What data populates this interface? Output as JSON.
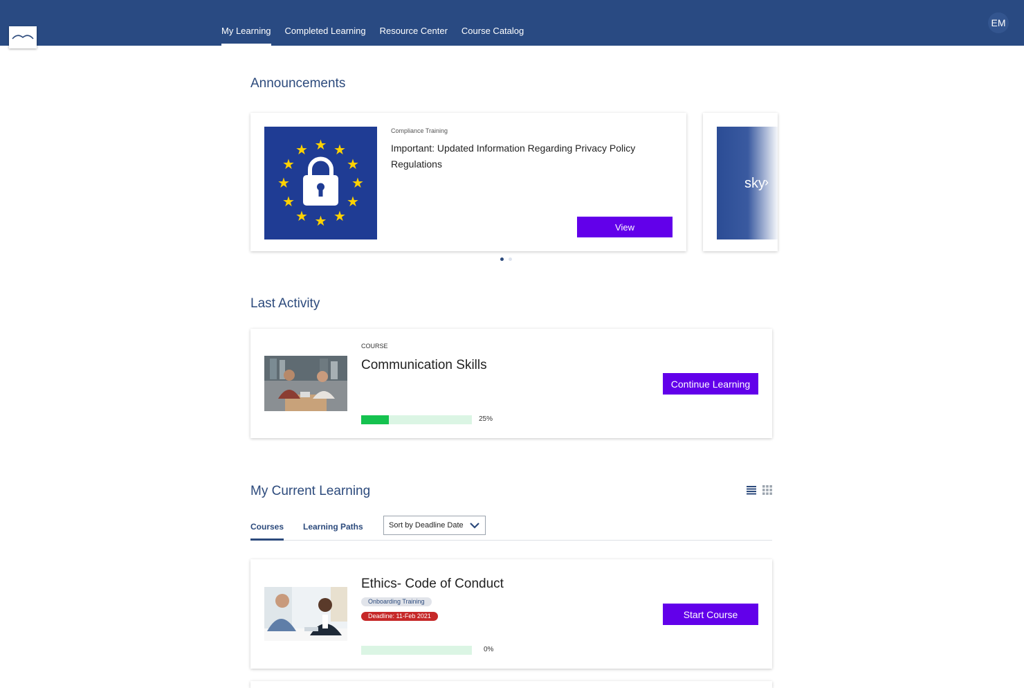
{
  "header": {
    "nav": [
      {
        "label": "My Learning",
        "active": true
      },
      {
        "label": "Completed Learning",
        "active": false
      },
      {
        "label": "Resource Center",
        "active": false
      },
      {
        "label": "Course Catalog",
        "active": false
      }
    ],
    "user_initials": "EM",
    "bar_color": "#294a82"
  },
  "announcements": {
    "title": "Announcements",
    "items": [
      {
        "category": "Compliance Training",
        "headline": "Important: Updated Information Regarding Privacy Policy Regulations",
        "button_label": "View",
        "image_icon": "eu-privacy-lock-icon"
      },
      {
        "image_text": "sky",
        "next_glyph": "›"
      }
    ],
    "pagination": {
      "count": 2,
      "active": 0
    }
  },
  "last_activity": {
    "title": "Last Activity",
    "item": {
      "kind": "COURSE",
      "title": "Communication Skills",
      "progress": 0.25,
      "progress_label": "25%",
      "button_label": "Continue Learning"
    }
  },
  "current_learning": {
    "title": "My Current Learning",
    "view_icons": [
      "list-view-icon",
      "grid-view-icon"
    ],
    "tabs": [
      {
        "label": "Courses",
        "active": true
      },
      {
        "label": "Learning Paths",
        "active": false
      }
    ],
    "sort": {
      "label": "Sort by Deadline Date"
    },
    "courses": [
      {
        "title": "Ethics- Code of Conduct",
        "category_tag": "Onboarding Training",
        "deadline_tag": "Deadline: 11-Feb 2021",
        "progress": 0,
        "progress_label": "0%",
        "button_label": "Start Course"
      }
    ]
  },
  "colors": {
    "accent": "#6200ea",
    "heading": "#2c4a7c",
    "progress_fill": "#15c24f",
    "progress_track": "#dbf5e4",
    "deadline": "#c62828"
  }
}
